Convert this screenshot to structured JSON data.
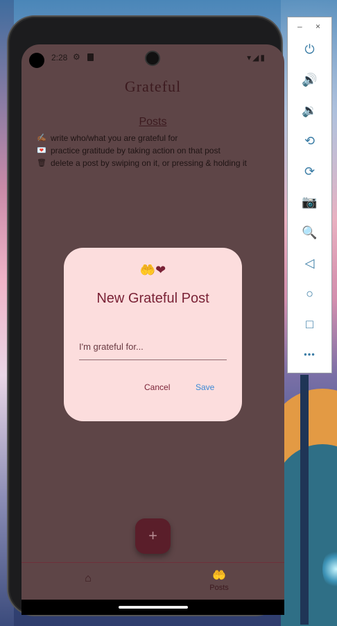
{
  "emulator": {
    "minimize": "–",
    "close": "×",
    "buttons": [
      {
        "name": "power-button",
        "icon": "power-icon",
        "glyph": "⏻"
      },
      {
        "name": "volume-up-button",
        "icon": "volume-up-icon",
        "glyph": "🔊"
      },
      {
        "name": "volume-down-button",
        "icon": "volume-down-icon",
        "glyph": "🔉"
      },
      {
        "name": "rotate-left-button",
        "icon": "rotate-left-icon",
        "glyph": "⟲"
      },
      {
        "name": "rotate-right-button",
        "icon": "rotate-right-icon",
        "glyph": "⟳"
      },
      {
        "name": "screenshot-button",
        "icon": "camera-icon",
        "glyph": "📷"
      },
      {
        "name": "zoom-button",
        "icon": "zoom-in-icon",
        "glyph": "🔍"
      },
      {
        "name": "back-button",
        "icon": "back-triangle-icon",
        "glyph": "◁"
      },
      {
        "name": "home-button",
        "icon": "home-circle-icon",
        "glyph": "○"
      },
      {
        "name": "overview-button",
        "icon": "overview-square-icon",
        "glyph": "□"
      },
      {
        "name": "more-button",
        "icon": "more-dots-icon",
        "glyph": "•••"
      }
    ]
  },
  "status_bar": {
    "time": "2:28",
    "gear_glyph": "⚙",
    "right_glyphs": "▾◢▮"
  },
  "app": {
    "title": "Grateful",
    "posts_heading": "Posts",
    "tips": [
      {
        "icon": "✍🏾",
        "text": "write who/what you are grateful for"
      },
      {
        "icon": "💌",
        "text": "practice gratitude by taking action on that post"
      },
      {
        "icon": "🗑",
        "text": "delete a post by swiping on it, or pressing & holding it"
      }
    ],
    "fab_label": "+"
  },
  "dialog": {
    "icon_glyph": "🤲❤",
    "title": "New Grateful Post",
    "input_placeholder": "I'm grateful for...",
    "cancel_label": "Cancel",
    "save_label": "Save"
  },
  "bottom_nav": {
    "home_glyph": "⌂",
    "posts_glyph": "🤲",
    "posts_label": "Posts"
  },
  "colors": {
    "accent": "#7a2236",
    "dialog_bg": "#fcdddd",
    "save_blue": "#3a89d6",
    "scrim_bg": "#5e4547"
  }
}
